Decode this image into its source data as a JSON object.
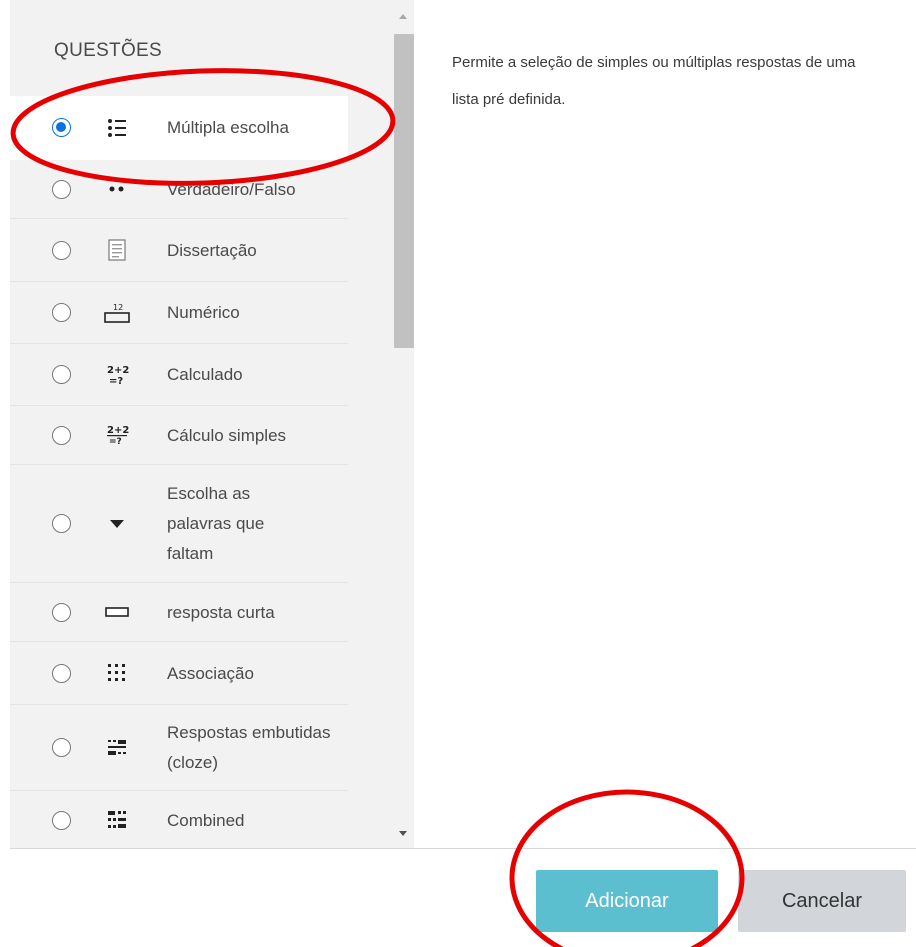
{
  "section_title": "QUESTÕES",
  "questions": [
    {
      "label": "Múltipla escolha",
      "icon": "multichoice-list-icon",
      "selected": true
    },
    {
      "label": "Verdadeiro/Falso",
      "icon": "truefalse-dots-icon",
      "selected": false
    },
    {
      "label": "Dissertação",
      "icon": "essay-document-icon",
      "selected": false
    },
    {
      "label": "Numérico",
      "icon": "numerical-12-icon",
      "selected": false
    },
    {
      "label": "Calculado",
      "icon": "calculated-2plus2-icon",
      "selected": false
    },
    {
      "label": "Cálculo simples",
      "icon": "calculated-simple-icon",
      "selected": false
    },
    {
      "label": "Escolha as palavras que faltam",
      "icon": "dropdown-triangle-icon",
      "selected": false
    },
    {
      "label": "resposta curta",
      "icon": "short-answer-box-icon",
      "selected": false
    },
    {
      "label": "Associação",
      "icon": "matching-grid-icon",
      "selected": false
    },
    {
      "label": "Respostas embutidas (cloze)",
      "icon": "cloze-icon",
      "selected": false
    },
    {
      "label": "Combined",
      "icon": "combined-icon",
      "selected": false
    }
  ],
  "description": "Permite a seleção de simples ou múltiplas respostas de uma lista pré definida.",
  "buttons": {
    "add": "Adicionar",
    "cancel": "Cancelar"
  },
  "colors": {
    "accent_radio": "#0a72e0",
    "add_button": "#5cbfd0",
    "cancel_button": "#d2d6da",
    "annotation": "#e60000"
  }
}
